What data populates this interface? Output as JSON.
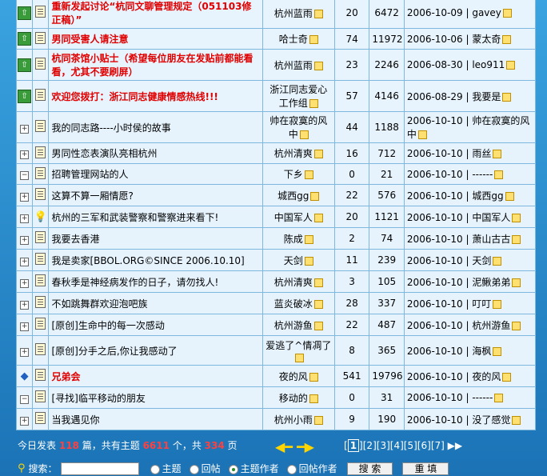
{
  "rows": [
    {
      "type": "pinned",
      "title": "重新发起讨论“杭同文聊管理规定（051103修正稿）”",
      "author": "杭州蓝雨",
      "replies": "20",
      "views": "6472",
      "last": "2006-10-09 | gavey"
    },
    {
      "type": "pinned",
      "title": "男同受害人请注意",
      "author": "哈士奇",
      "replies": "74",
      "views": "11972",
      "last": "2006-10-06 | 蒙太奇"
    },
    {
      "type": "pinned",
      "title": "杭同茶馆小贴士（希望每位朋友在发贴前都能看看，尤其不要刷屏）",
      "author": "杭州蓝雨",
      "replies": "23",
      "views": "2246",
      "last": "2006-08-30 | leo911"
    },
    {
      "type": "pinned",
      "title": "欢迎您拨打：浙江同志健康情感热线!!!",
      "author": "浙江同志爱心工作组",
      "replies": "57",
      "views": "4146",
      "last": "2006-08-29 | 我要是"
    },
    {
      "type": "normal",
      "title": "我的同志路----小时侯的故事",
      "author": "帅在寂寞的风中",
      "replies": "44",
      "views": "1188",
      "last": "2006-10-10 | 帅在寂寞的风中"
    },
    {
      "type": "normal",
      "title": "男同性恋表演队亮相杭州",
      "author": "杭州清爽",
      "replies": "16",
      "views": "712",
      "last": "2006-10-10 | 雨丝"
    },
    {
      "type": "minus",
      "title": "招聘管理网站的人",
      "author": "下乡",
      "replies": "0",
      "views": "21",
      "last": "2006-10-10 | ------"
    },
    {
      "type": "normal",
      "title": "这算不算一厢情愿?",
      "author": "城西gg",
      "replies": "22",
      "views": "576",
      "last": "2006-10-10 | 城西gg"
    },
    {
      "type": "bulb",
      "title": "杭州的三军和武装警察和警察进来看下!",
      "author": "中国军人",
      "replies": "20",
      "views": "1121",
      "last": "2006-10-10 | 中国军人"
    },
    {
      "type": "normal",
      "title": "我要去香港",
      "author": "陈成",
      "replies": "2",
      "views": "74",
      "last": "2006-10-10 | 萧山古古"
    },
    {
      "type": "normal",
      "title": "我是卖家[BBOL.ORG©SINCE 2006.10.10]",
      "author": "天剑",
      "replies": "11",
      "views": "239",
      "last": "2006-10-10 | 天剑"
    },
    {
      "type": "normal",
      "title": "春秋季是神经病发作的日子，请勿找人!",
      "author": "杭州清爽",
      "replies": "3",
      "views": "105",
      "last": "2006-10-10 | 泥鳅弟弟"
    },
    {
      "type": "normal",
      "title": "不如跳舞群欢迎泡吧族",
      "author": "蓝炎破冰",
      "replies": "28",
      "views": "337",
      "last": "2006-10-10 | 叮叮"
    },
    {
      "type": "normal",
      "title": "[原创]生命中的每一次感动",
      "author": "杭州游鱼",
      "replies": "22",
      "views": "487",
      "last": "2006-10-10 | 杭州游鱼"
    },
    {
      "type": "normal",
      "title": "[原创]分手之后,你让我感动了",
      "author": "爱逃了^情凋了",
      "replies": "8",
      "views": "365",
      "last": "2006-10-10 | 海枫"
    },
    {
      "type": "bird",
      "title": "兄弟会",
      "author": "夜的风",
      "replies": "541",
      "views": "19796",
      "last": "2006-10-10 | 夜的风"
    },
    {
      "type": "minus",
      "title": "[寻找]临平移动的朋友",
      "author": "移动的",
      "replies": "0",
      "views": "31",
      "last": "2006-10-10 | ------"
    },
    {
      "type": "normal",
      "title": "当我遇见你",
      "author": "杭州小雨",
      "replies": "9",
      "views": "190",
      "last": "2006-10-10 | 没了感觉"
    }
  ],
  "footer": {
    "today_label": "今日发表",
    "today_count": "118",
    "mid1": "篇，共有主题",
    "topic_count": "6611",
    "mid2": "个，共",
    "page_total": "334",
    "mid3": "页",
    "pages": [
      "1",
      "2",
      "3",
      "4",
      "5",
      "6",
      "7"
    ],
    "current_page": "1"
  },
  "search": {
    "label": "搜索：",
    "value": "",
    "options": [
      "主题",
      "回帖",
      "主题作者",
      "回帖作者"
    ],
    "selected": "主题作者",
    "search_button": "搜 索",
    "reset_button": "重 填"
  }
}
